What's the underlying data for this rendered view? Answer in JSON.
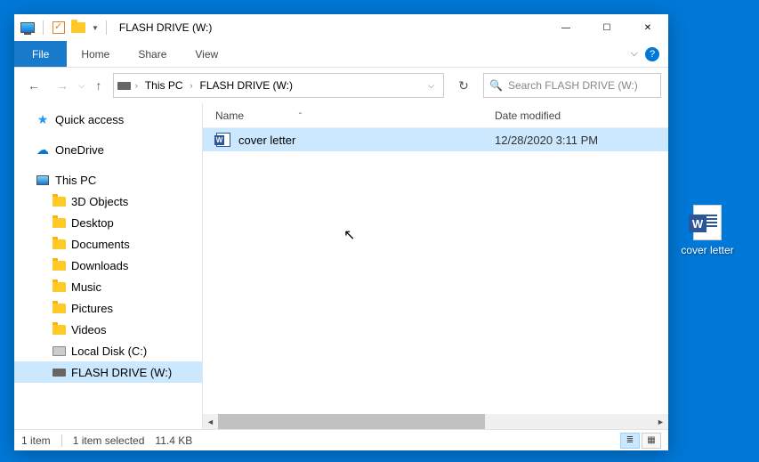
{
  "window": {
    "title": "FLASH DRIVE (W:)",
    "controls": {
      "min": "—",
      "max": "☐",
      "close": "✕"
    }
  },
  "ribbon": {
    "file": "File",
    "tabs": [
      "Home",
      "Share",
      "View"
    ]
  },
  "breadcrumb": {
    "items": [
      "This PC",
      "FLASH DRIVE (W:)"
    ]
  },
  "search": {
    "placeholder": "Search FLASH DRIVE (W:)"
  },
  "tree": {
    "quick_access": "Quick access",
    "onedrive": "OneDrive",
    "this_pc": "This PC",
    "folders": [
      "3D Objects",
      "Desktop",
      "Documents",
      "Downloads",
      "Music",
      "Pictures",
      "Videos"
    ],
    "local_disk": "Local Disk (C:)",
    "flash_drive": "FLASH DRIVE (W:)"
  },
  "columns": {
    "name": "Name",
    "date": "Date modified"
  },
  "files": [
    {
      "name": "cover letter",
      "date": "12/28/2020 3:11 PM",
      "selected": true
    }
  ],
  "status": {
    "count": "1 item",
    "selected": "1 item selected",
    "size": "11.4 KB"
  },
  "desktop": {
    "file": "cover letter"
  }
}
